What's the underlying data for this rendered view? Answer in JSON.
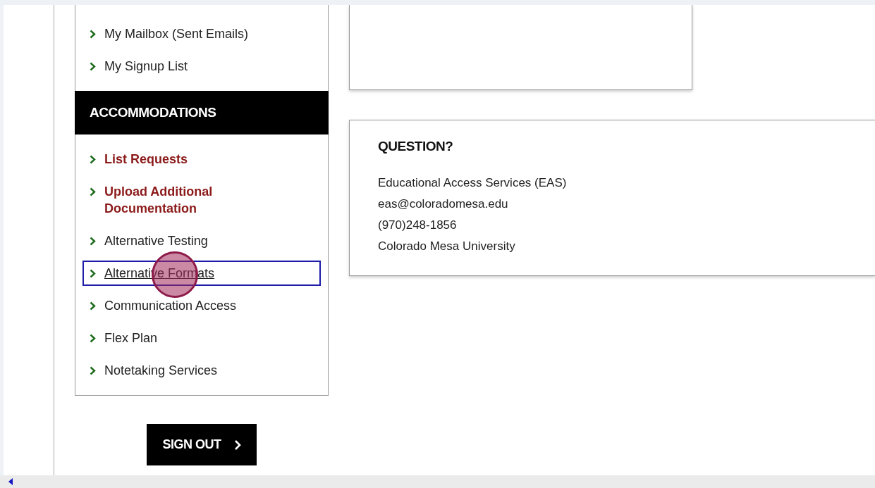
{
  "sidebar": {
    "top_links": [
      {
        "label": "My Mailbox (Sent Emails)"
      },
      {
        "label": "My Signup List"
      }
    ],
    "section_title": "ACCOMMODATIONS",
    "links": [
      {
        "label": "List Requests",
        "emphasized": true,
        "focused": false
      },
      {
        "label": "Upload Additional Documentation",
        "emphasized": true,
        "focused": false
      },
      {
        "label": "Alternative Testing",
        "emphasized": false,
        "focused": false
      },
      {
        "label": "Alternative Formats",
        "emphasized": false,
        "focused": true
      },
      {
        "label": "Communication Access",
        "emphasized": false,
        "focused": false
      },
      {
        "label": "Flex Plan",
        "emphasized": false,
        "focused": false
      },
      {
        "label": "Notetaking Services",
        "emphasized": false,
        "focused": false
      }
    ]
  },
  "sign_out": {
    "label": "SIGN OUT"
  },
  "question_card": {
    "title": "QUESTION?",
    "lines": [
      "Educational Access Services (EAS)",
      "eas@coloradomesa.edu",
      "(970)248-1856",
      "Colorado Mesa University"
    ]
  }
}
